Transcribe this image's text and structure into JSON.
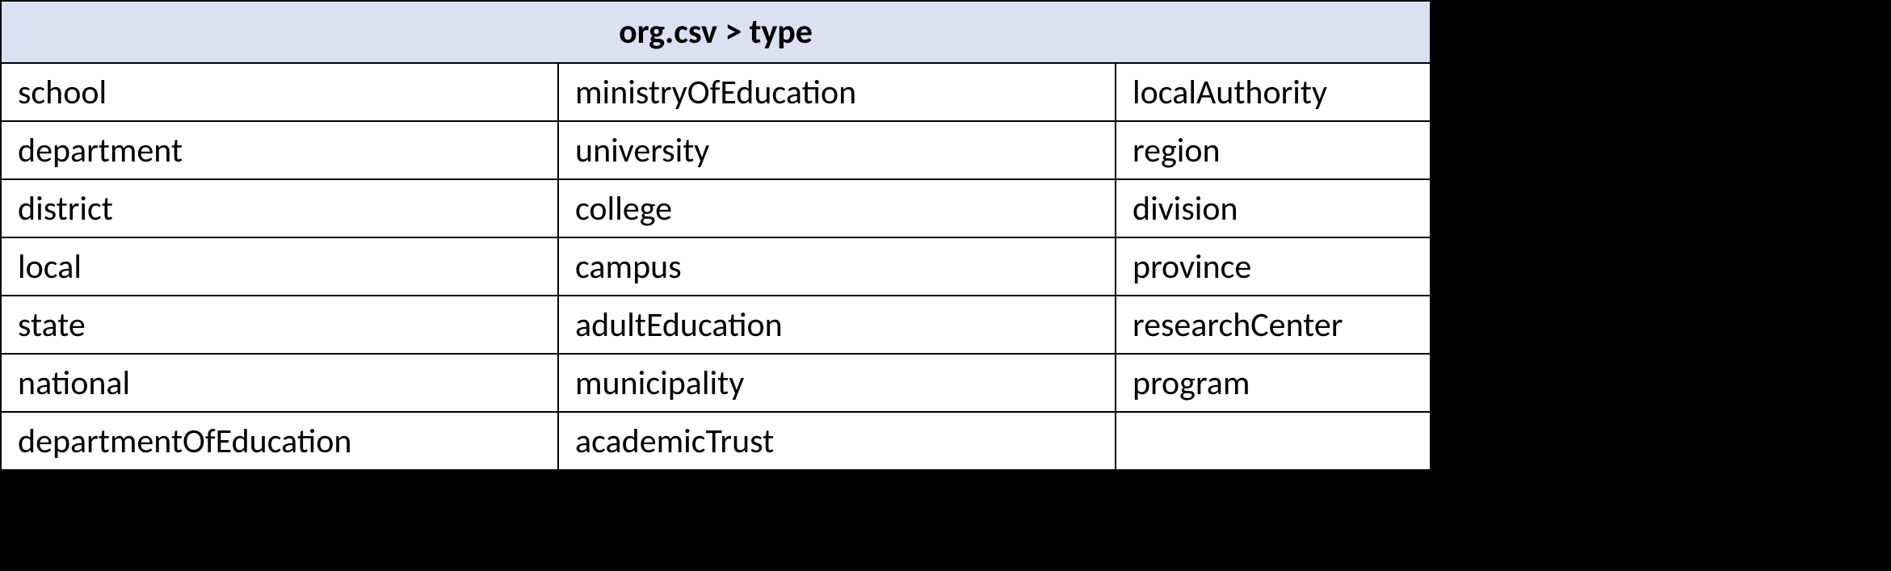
{
  "table": {
    "header": "org.csv > type",
    "rows": [
      {
        "c1": "school",
        "c2": "ministryOfEducation",
        "c3": "localAuthority"
      },
      {
        "c1": "department",
        "c2": "university",
        "c3": "region"
      },
      {
        "c1": "district",
        "c2": "college",
        "c3": "division"
      },
      {
        "c1": "local",
        "c2": "campus",
        "c3": "province"
      },
      {
        "c1": "state",
        "c2": "adultEducation",
        "c3": "researchCenter"
      },
      {
        "c1": "national",
        "c2": "municipality",
        "c3": "program"
      },
      {
        "c1": "departmentOfEducation",
        "c2": "academicTrust",
        "c3": ""
      }
    ]
  }
}
